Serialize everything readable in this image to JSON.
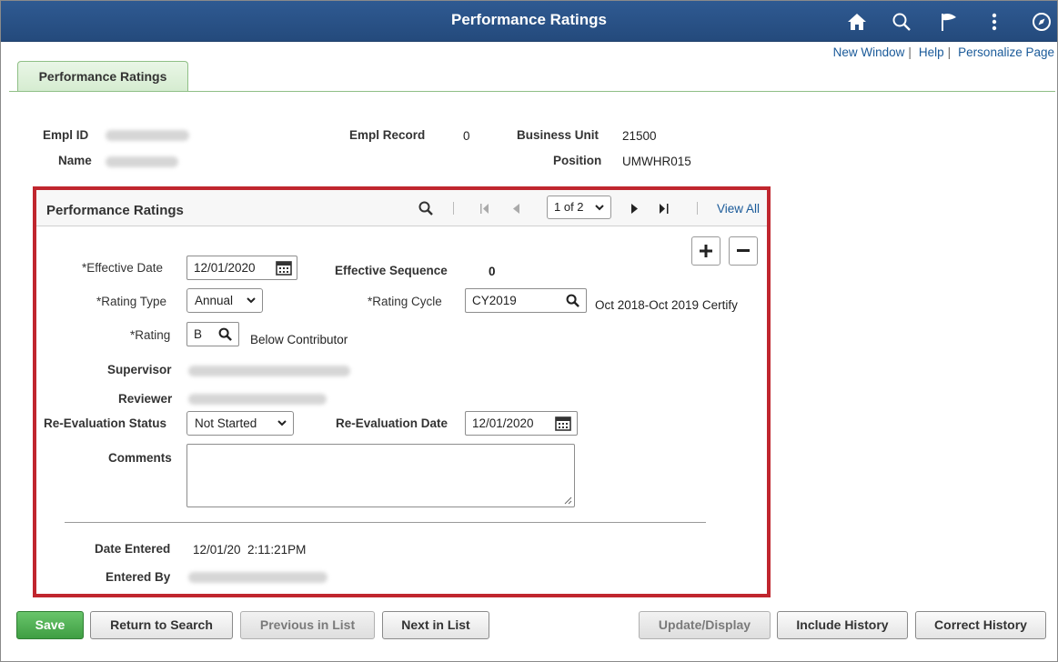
{
  "banner": {
    "title": "Performance Ratings",
    "icons": [
      "home-icon",
      "search-icon",
      "flag-icon",
      "more-vertical-icon",
      "compass-icon"
    ]
  },
  "toplinks": {
    "new_window": "New Window",
    "help": "Help",
    "personalize": "Personalize Page"
  },
  "page_tab": "Performance Ratings",
  "header": {
    "empl_id_label": "Empl ID",
    "name_label": "Name",
    "empl_record_label": "Empl Record",
    "empl_record_value": "0",
    "business_unit_label": "Business Unit",
    "business_unit_value": "21500",
    "position_label": "Position",
    "position_value": "UMWHR015"
  },
  "grid": {
    "title": "Performance Ratings",
    "pager_value": "1 of 2",
    "view_all": "View All",
    "effective_date_label": "*Effective Date",
    "effective_date_value": "12/01/2020",
    "effective_seq_label": "Effective Sequence",
    "effective_seq_value": "0",
    "rating_type_label": "*Rating Type",
    "rating_type_value": "Annual",
    "rating_cycle_label": "*Rating Cycle",
    "rating_cycle_value": "CY2019",
    "rating_cycle_desc": "Oct 2018-Oct 2019 Certify",
    "rating_label": "*Rating",
    "rating_value": "B",
    "rating_desc": "Below Contributor",
    "supervisor_label": "Supervisor",
    "reviewer_label": "Reviewer",
    "reeval_status_label": "Re-Evaluation Status",
    "reeval_status_value": "Not Started",
    "reeval_date_label": "Re-Evaluation Date",
    "reeval_date_value": "12/01/2020",
    "comments_label": "Comments",
    "comments_value": "",
    "date_entered_label": "Date Entered",
    "date_entered_value": "12/01/20  2:11:21PM",
    "entered_by_label": "Entered By"
  },
  "buttons": {
    "save": "Save",
    "return": "Return to Search",
    "previous": "Previous in List",
    "next": "Next in List",
    "update": "Update/Display",
    "include": "Include History",
    "correct": "Correct History"
  },
  "colors": {
    "banner": "#2a5286",
    "highlight_border": "#c0262e",
    "save_button": "#4caf50",
    "tab": "#dff0da"
  }
}
